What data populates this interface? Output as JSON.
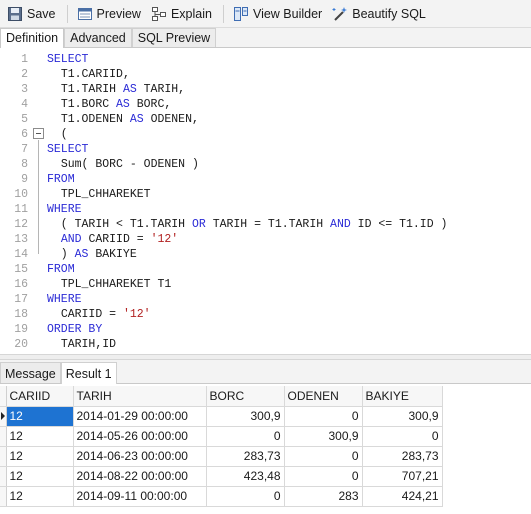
{
  "toolbar": {
    "save_label": "Save",
    "preview_label": "Preview",
    "explain_label": "Explain",
    "view_builder_label": "View Builder",
    "beautify_label": "Beautify SQL"
  },
  "tabs": [
    "Definition",
    "Advanced",
    "SQL Preview"
  ],
  "editor": {
    "lines": [
      "SELECT",
      "  T1.CARIID,",
      "  T1.TARIH AS TARIH,",
      "  T1.BORC AS BORC,",
      "  T1.ODENEN AS ODENEN,",
      "  (",
      "SELECT",
      "  Sum( BORC - ODENEN )",
      "FROM",
      "  TPL_CHHAREKET",
      "WHERE",
      "  ( TARIH < T1.TARIH OR TARIH = T1.TARIH AND ID <= T1.ID )",
      "  AND CARIID = '12'",
      "  ) AS BAKIYE",
      "FROM",
      "  TPL_CHHAREKET T1",
      "WHERE",
      "  CARIID = '12'",
      "ORDER BY",
      "  TARIH,ID"
    ]
  },
  "result_tabs": [
    "Message",
    "Result 1"
  ],
  "grid": {
    "columns": [
      "CARIID",
      "TARIH",
      "BORC",
      "ODENEN",
      "BAKIYE"
    ],
    "rows": [
      [
        "12",
        "2014-01-29 00:00:00",
        "300,9",
        "0",
        "300,9"
      ],
      [
        "12",
        "2014-05-26 00:00:00",
        "0",
        "300,9",
        "0"
      ],
      [
        "12",
        "2014-06-23 00:00:00",
        "283,73",
        "0",
        "283,73"
      ],
      [
        "12",
        "2014-08-22 00:00:00",
        "423,48",
        "0",
        "707,21"
      ],
      [
        "12",
        "2014-09-11 00:00:00",
        "0",
        "283",
        "424,21"
      ]
    ]
  },
  "colors": {
    "keyword": "#2b2bd6",
    "string": "#b22222",
    "selection": "#1e73d2"
  }
}
